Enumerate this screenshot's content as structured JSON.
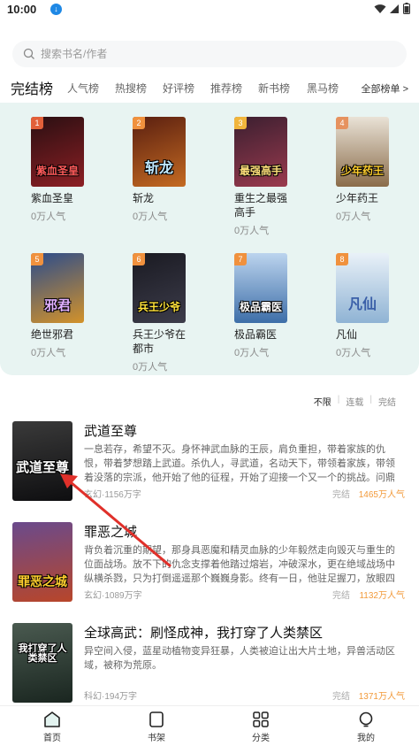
{
  "status_bar": {
    "time": "10:00",
    "download_glyph": "↓"
  },
  "search": {
    "placeholder": "搜索书名/作者",
    "value": ""
  },
  "tabs": {
    "active": "完结榜",
    "items": [
      "人气榜",
      "热搜榜",
      "好评榜",
      "推荐榜",
      "新书榜",
      "黑马榜"
    ],
    "more": "全部榜单 >"
  },
  "rankings": [
    {
      "rank": "1",
      "name": "紫血圣皇",
      "cover_text": "紫血圣皇",
      "popularity": "0万人气",
      "color_top": "#2a0f12",
      "color_bottom": "#8c1f24"
    },
    {
      "rank": "2",
      "name": "斩龙",
      "cover_text": "斩龙",
      "popularity": "0万人气",
      "color_top": "#5a1f10",
      "color_bottom": "#c46a22"
    },
    {
      "rank": "3",
      "name": "重生之最强高手",
      "cover_text": "最强高手",
      "popularity": "0万人气",
      "color_top": "#3b1f30",
      "color_bottom": "#9a3a4e"
    },
    {
      "rank": "4",
      "name": "少年药王",
      "cover_text": "少年药王",
      "popularity": "0万人气",
      "color_top": "#e9e2d6",
      "color_bottom": "#8a6c4a"
    },
    {
      "rank": "5",
      "name": "绝世邪君",
      "cover_text": "邪君",
      "popularity": "0万人气",
      "color_top": "#2b4c8c",
      "color_bottom": "#d3922a"
    },
    {
      "rank": "6",
      "name": "兵王少爷在都市",
      "cover_text": "兵王少爷",
      "popularity": "0万人气",
      "color_top": "#1a1a22",
      "color_bottom": "#3c3c4a"
    },
    {
      "rank": "7",
      "name": "极品霸医",
      "cover_text": "极品霸医",
      "popularity": "0万人气",
      "color_top": "#bcd4ee",
      "color_bottom": "#3d6ea8"
    },
    {
      "rank": "8",
      "name": "凡仙",
      "cover_text": "凡仙",
      "popularity": "0万人气",
      "color_top": "#e9f1f8",
      "color_bottom": "#8fb3d4"
    }
  ],
  "filter": {
    "options": [
      "不限",
      "连载",
      "完结"
    ],
    "selected": "不限"
  },
  "books": [
    {
      "title": "武道至尊",
      "cover_text": "武道至尊",
      "description": "一息若存，希望不灭。身怀神武血脉的王辰，肩负重担，带着家族的仇恨，带着梦想踏上武道。杀仇人，寻武道，名动天下，带领着家族，带领着没落的宗派，他开始了他的征程，开始了迎接一个又一个的挑战。问鼎之路，何其困难…",
      "meta": "玄幻·1156万字",
      "status": "完结",
      "popularity": "1465万人气",
      "color_top": "#3a3a3a",
      "color_bottom": "#0e0e10"
    },
    {
      "title": "罪恶之城",
      "cover_text": "罪恶之城",
      "description": "背负着沉重的期望，那身具恶魔和精灵血脉的少年毅然走向毁灭与重生的位面战场。放不下的仇念支撑着他踏过熔岩，冲破深水，更在绝域战场中纵横杀戮，只为打倒遥遥那个巍巍身影。终有一日，他驻足握刀，放眼四顾，却…",
      "meta": "玄幻·1089万字",
      "status": "完结",
      "popularity": "1132万人气",
      "color_top": "#6a4a8c",
      "color_bottom": "#b8462a"
    },
    {
      "title": "全球高武：刷怪成神，我打穿了人类禁区",
      "cover_text": "我打穿了人类禁区",
      "description": "异空间入侵，蓝星动植物变异狂暴，人类被迫让出大片土地，异兽活动区域，被称为荒原。",
      "meta": "科幻·194万字",
      "status": "完结",
      "popularity": "1371万人气",
      "color_top": "#4a5a50",
      "color_bottom": "#1a2620"
    }
  ],
  "bottom_nav": [
    {
      "label": "首页",
      "icon": "home-icon"
    },
    {
      "label": "书架",
      "icon": "bookshelf-icon"
    },
    {
      "label": "分类",
      "icon": "category-icon"
    },
    {
      "label": "我的",
      "icon": "profile-icon"
    }
  ],
  "colors": {
    "panel_bg": "#e8f4f2",
    "popularity_orange": "#f29a3a",
    "badge_red": "#e2603a"
  }
}
